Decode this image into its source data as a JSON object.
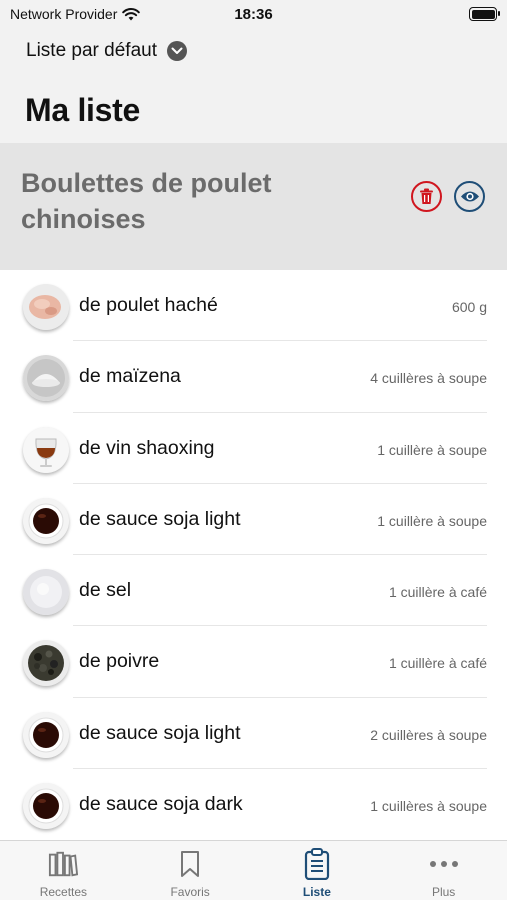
{
  "status_bar": {
    "carrier": "Network Provider",
    "time": "18:36"
  },
  "header": {
    "list_selector": "Liste par défaut",
    "title": "Ma liste"
  },
  "recipe": {
    "title": "Boulettes de poulet chinoises"
  },
  "ingredients": [
    {
      "name": "de poulet haché",
      "quantity": "600 g",
      "icon": "chicken"
    },
    {
      "name": "de maïzena",
      "quantity": "4 cuillères à soupe",
      "icon": "cornstarch"
    },
    {
      "name": "de vin shaoxing",
      "quantity": "1 cuillère à soupe",
      "icon": "wine"
    },
    {
      "name": "de sauce soja light",
      "quantity": "1 cuillère à soupe",
      "icon": "soy-sauce"
    },
    {
      "name": "de sel",
      "quantity": "1 cuillère à café",
      "icon": "salt"
    },
    {
      "name": "de poivre",
      "quantity": "1 cuillère à café",
      "icon": "pepper"
    },
    {
      "name": "de sauce soja light",
      "quantity": "2 cuillères à soupe",
      "icon": "soy-sauce"
    },
    {
      "name": "de sauce soja dark",
      "quantity": "1 cuillères à soupe",
      "icon": "soy-sauce"
    }
  ],
  "tabs": [
    {
      "label": "Recettes",
      "icon": "books-icon",
      "active": false
    },
    {
      "label": "Favoris",
      "icon": "bookmark-icon",
      "active": false
    },
    {
      "label": "Liste",
      "icon": "clipboard-icon",
      "active": true
    },
    {
      "label": "Plus",
      "icon": "more-icon",
      "active": false
    }
  ],
  "colors": {
    "accent": "#1f4e77",
    "delete": "#d0161f",
    "header_bg": "#e4e4e4"
  }
}
